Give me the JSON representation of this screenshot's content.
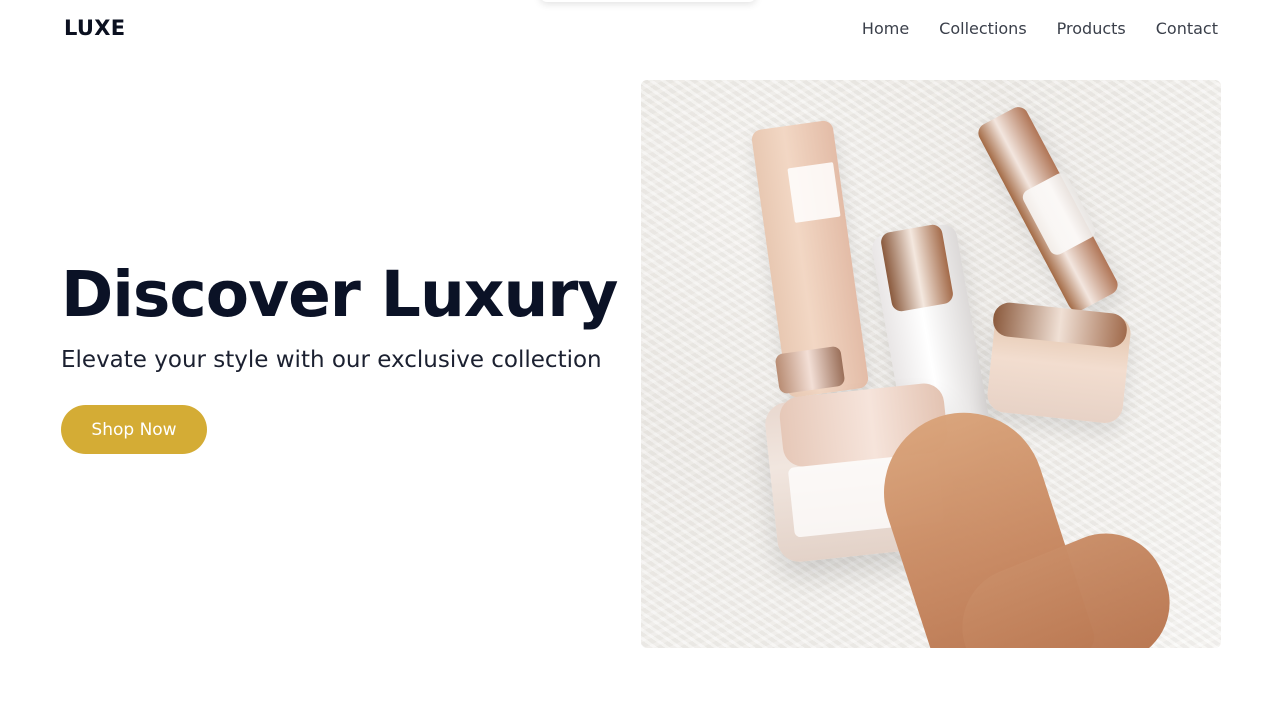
{
  "header": {
    "logo": "LUXE",
    "nav": [
      {
        "label": "Home"
      },
      {
        "label": "Collections"
      },
      {
        "label": "Products"
      },
      {
        "label": "Contact"
      }
    ]
  },
  "hero": {
    "title": "Discover Luxury",
    "subtitle": "Elevate your style with our exclusive collection",
    "cta_label": "Shop Now",
    "cta_color": "#d4ac35"
  },
  "image": {
    "alt": ""
  }
}
